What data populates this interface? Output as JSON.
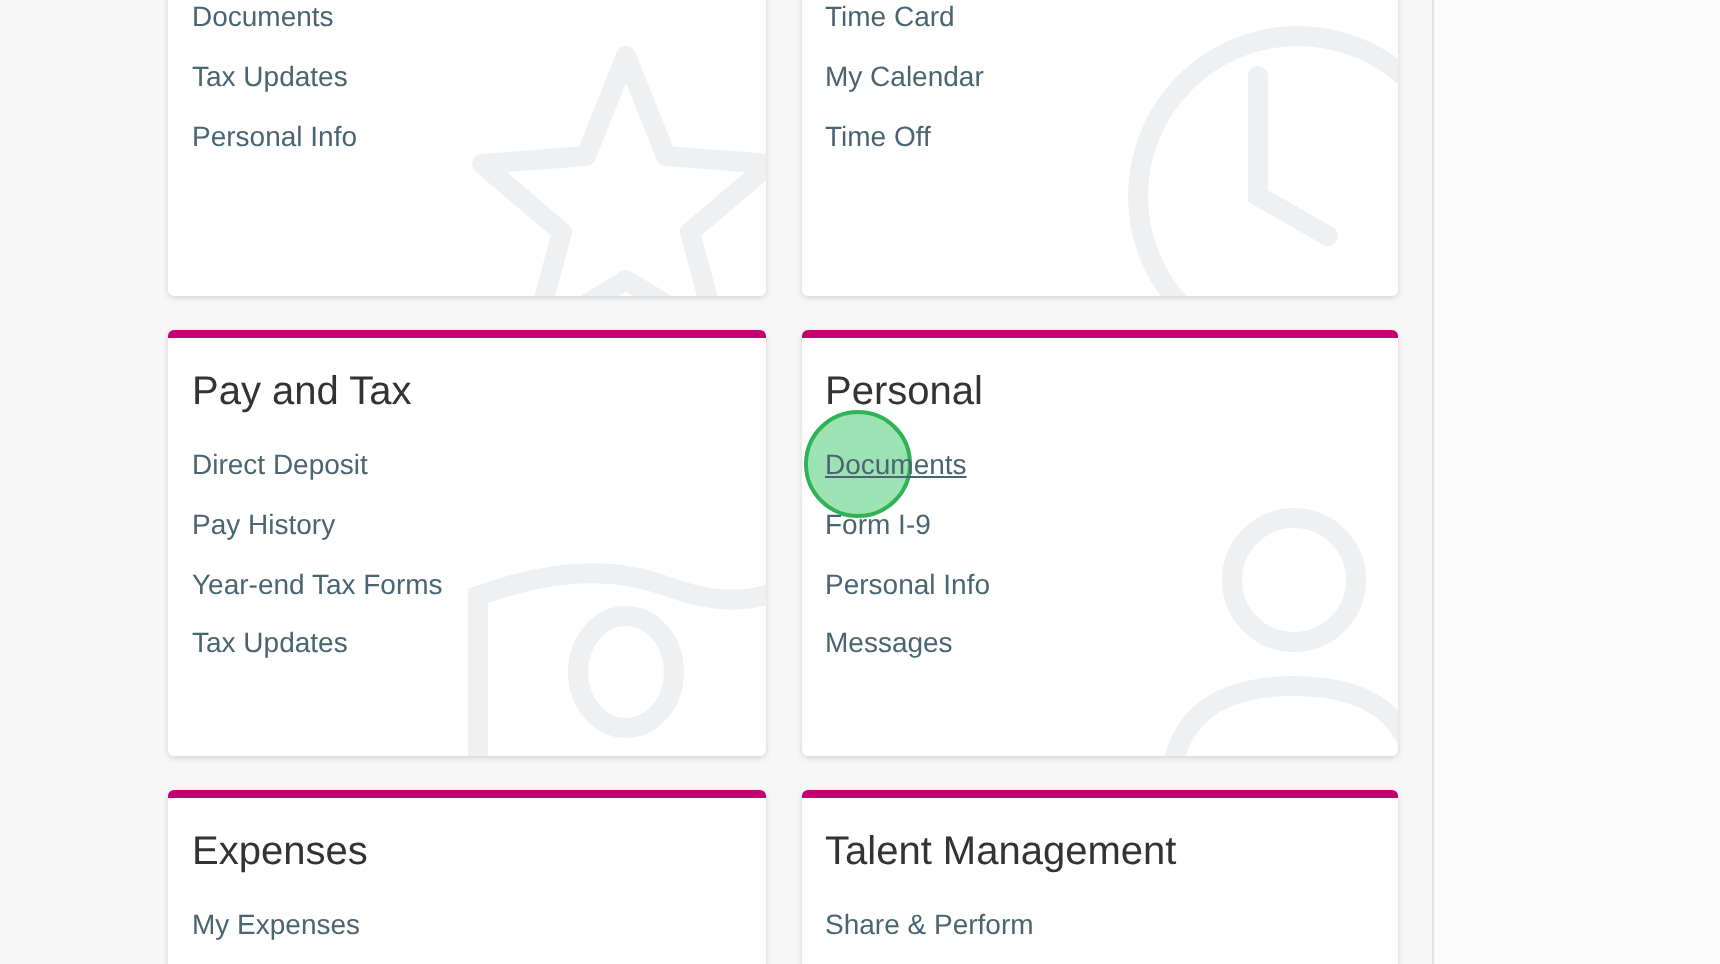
{
  "cards": [
    {
      "links": [
        {
          "label": "Documents",
          "clicked": false
        },
        {
          "label": "Tax Updates",
          "clicked": false
        },
        {
          "label": "Personal Info",
          "clicked": false
        }
      ]
    },
    {
      "links": [
        {
          "label": "Time Card",
          "clicked": false
        },
        {
          "label": "My Calendar",
          "clicked": false
        },
        {
          "label": "Time Off",
          "clicked": false
        }
      ]
    },
    {
      "title": "Pay and Tax",
      "links": [
        {
          "label": "Direct Deposit",
          "clicked": false
        },
        {
          "label": "Pay History",
          "clicked": false
        },
        {
          "label": "Year-end Tax Forms",
          "clicked": false
        },
        {
          "label": "Tax Updates",
          "clicked": false
        }
      ]
    },
    {
      "title": "Personal",
      "links": [
        {
          "label": "Documents",
          "clicked": true
        },
        {
          "label": "Form I-9",
          "clicked": false
        },
        {
          "label": "Personal Info",
          "clicked": false
        },
        {
          "label": "Messages",
          "clicked": false
        }
      ]
    },
    {
      "title": "Expenses",
      "links": [
        {
          "label": "My Expenses",
          "clicked": false
        }
      ]
    },
    {
      "title": "Talent Management",
      "links": [
        {
          "label": "Share & Perform",
          "clicked": false
        }
      ]
    }
  ]
}
